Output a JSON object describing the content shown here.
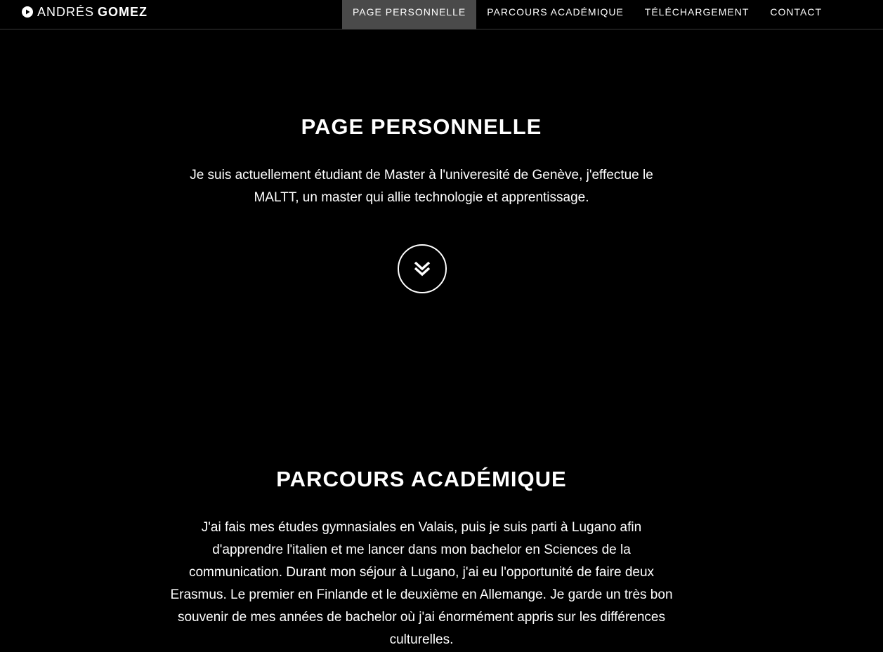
{
  "navbar": {
    "brand_first": "ANDRÉS",
    "brand_last": "GOMEZ",
    "brand_icon": "play-circle-icon",
    "links": [
      {
        "label": "PAGE PERSONNELLE",
        "active": true
      },
      {
        "label": "PARCOURS ACADÉMIQUE",
        "active": false
      },
      {
        "label": "TÉLÉCHARGEMENT",
        "active": false
      },
      {
        "label": "CONTACT",
        "active": false
      }
    ],
    "active_bg": "#4a4a4a"
  },
  "sections": [
    {
      "title": "PAGE PERSONNELLE",
      "text": "Je suis actuellement étudiant de Master à l'univeresité de Genève, j'effectue le MALTT, un master qui allie technologie et apprentissage."
    },
    {
      "title": "PARCOURS ACADÉMIQUE",
      "text": "J'ai fais mes études gymnasiales en Valais, puis je suis parti à Lugano afin d'apprendre l'italien et me lancer dans mon bachelor en Sciences de la communication. Durant mon séjour à Lugano, j'ai eu l'opportunité de faire deux Erasmus. Le premier en Finlande et le deuxième en Allemange. Je garde un très bon souvenir de mes années de bachelor où j'ai énormément appris sur les différences culturelles."
    }
  ],
  "scroll_button_icon": "double-chevron-down-icon",
  "colors": {
    "background": "#000000",
    "text": "#ffffff"
  }
}
